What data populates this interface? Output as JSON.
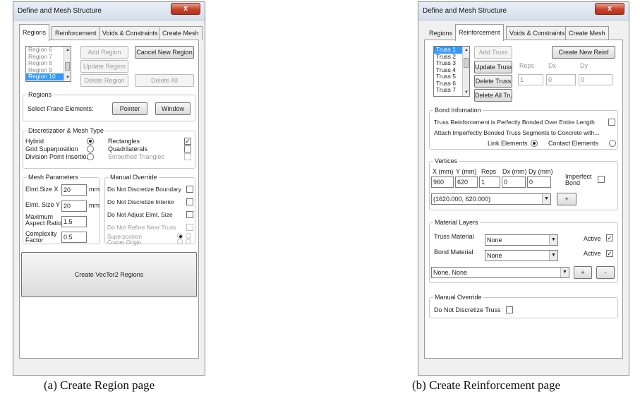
{
  "left_window": {
    "title": "Define and Mesh Structure",
    "close": "x",
    "tabs": [
      "Regions",
      "Reinforcement",
      "Voids & Constraints",
      "Create Mesh"
    ],
    "region_list": [
      "Region 6",
      "Region 7",
      "Region 8",
      "Region 9",
      "Region 10"
    ],
    "buttons": {
      "add_region": "Add Region",
      "cancel_new_region": "Cancel New Region",
      "update_region": "Update Region",
      "delete_region": "Delete Region",
      "delete_all": "Delete All"
    },
    "regions_group": {
      "legend": "Regions",
      "select_label": "Select Frane Elements:",
      "pointer": "Pointer",
      "window": "Window"
    },
    "discretization": {
      "legend": "Discretizatior & Mesh Type",
      "methods": [
        "Hybrid",
        "Grid Superposition",
        "Division Point Insertion"
      ],
      "selected_method": "Hybrid",
      "shapes": [
        "Rectangles",
        "Quadrilaterals",
        "Smoothed Triangles"
      ],
      "checked_shape": "Rectangles"
    },
    "mesh_params": {
      "legend": "Mesh Parameters",
      "elmt_x_label": "Elmt.Size X",
      "elmt_x": "20",
      "elmt_y_label": "Elmt. Size Y",
      "elmt_y": "20",
      "unit": "mm",
      "aspect_label_1": "Maximum",
      "aspect_label_2": "Aspect Ratio",
      "aspect": "1.5",
      "complexity_label_1": "Complexity",
      "complexity_label_2": "Factor",
      "complexity": "0.5"
    },
    "manual_override": {
      "legend": "Manual Override",
      "items": [
        "Do Not Discretize Boundary",
        "Do Not Discretize Interior",
        "Do Not Adjust Elmt. Size",
        "Do Not Refine Near Truss"
      ],
      "superposition": "Superposition",
      "corner_origin": "Corner Origin"
    },
    "create_button": "Create VecTor2 Regions"
  },
  "right_window": {
    "title": "Define and Mesh Structure",
    "close": "x",
    "tabs": [
      "Regions",
      "Reinforcement",
      "Voids & Constraints",
      "Create Mesh"
    ],
    "truss_list": [
      "Truss 1",
      "Truss 2",
      "Truss 3",
      "Truss 4",
      "Truss 5",
      "Truss 6",
      "Truss 7"
    ],
    "buttons": {
      "add_truss": "Add Truss",
      "create_new_reinf": "Create New Reinf",
      "update_truss": "Update Truss",
      "delete_truss": "Delete Truss",
      "delete_all_truss": "Delete All Truss"
    },
    "reps_label": "Reps",
    "dx_label": "Dx",
    "dy_label": "Dy",
    "reps_value": "1",
    "dx_value": "0",
    "dy_value": "0",
    "bond": {
      "legend": "Bond Infomation",
      "line1": "Truss Reinforcement is Perfectly Bonded Over Entire Length",
      "line2": "Attach Imperfectly Bonded Truss Segments to Concrete with...",
      "link": "Link Elements",
      "contact": "Contact Elements"
    },
    "vertices": {
      "legend": "Vertices",
      "headers": [
        "X (mm)",
        "Y (mm)",
        "Reps",
        "Dx (mm)",
        "Dy (mm)"
      ],
      "values": [
        "960",
        "620",
        "1",
        "0",
        "0"
      ],
      "imperfect_1": "Imperfect",
      "imperfect_2": "Bond",
      "combo": "(1620.000, 620.000)",
      "plus": "+"
    },
    "material": {
      "legend": "Material Layers",
      "truss_label": "Truss Material",
      "bond_label": "Bond Material",
      "truss_value": "None",
      "bond_value": "None",
      "active": "Active",
      "combo": "None, None",
      "plus": "+",
      "minus": "-"
    },
    "override": {
      "legend": "Manual Override",
      "label": "Do Not Discretize Truss"
    }
  },
  "captions": {
    "left": "(a) Create Region page",
    "right": "(b) Create Reinforcement page"
  }
}
